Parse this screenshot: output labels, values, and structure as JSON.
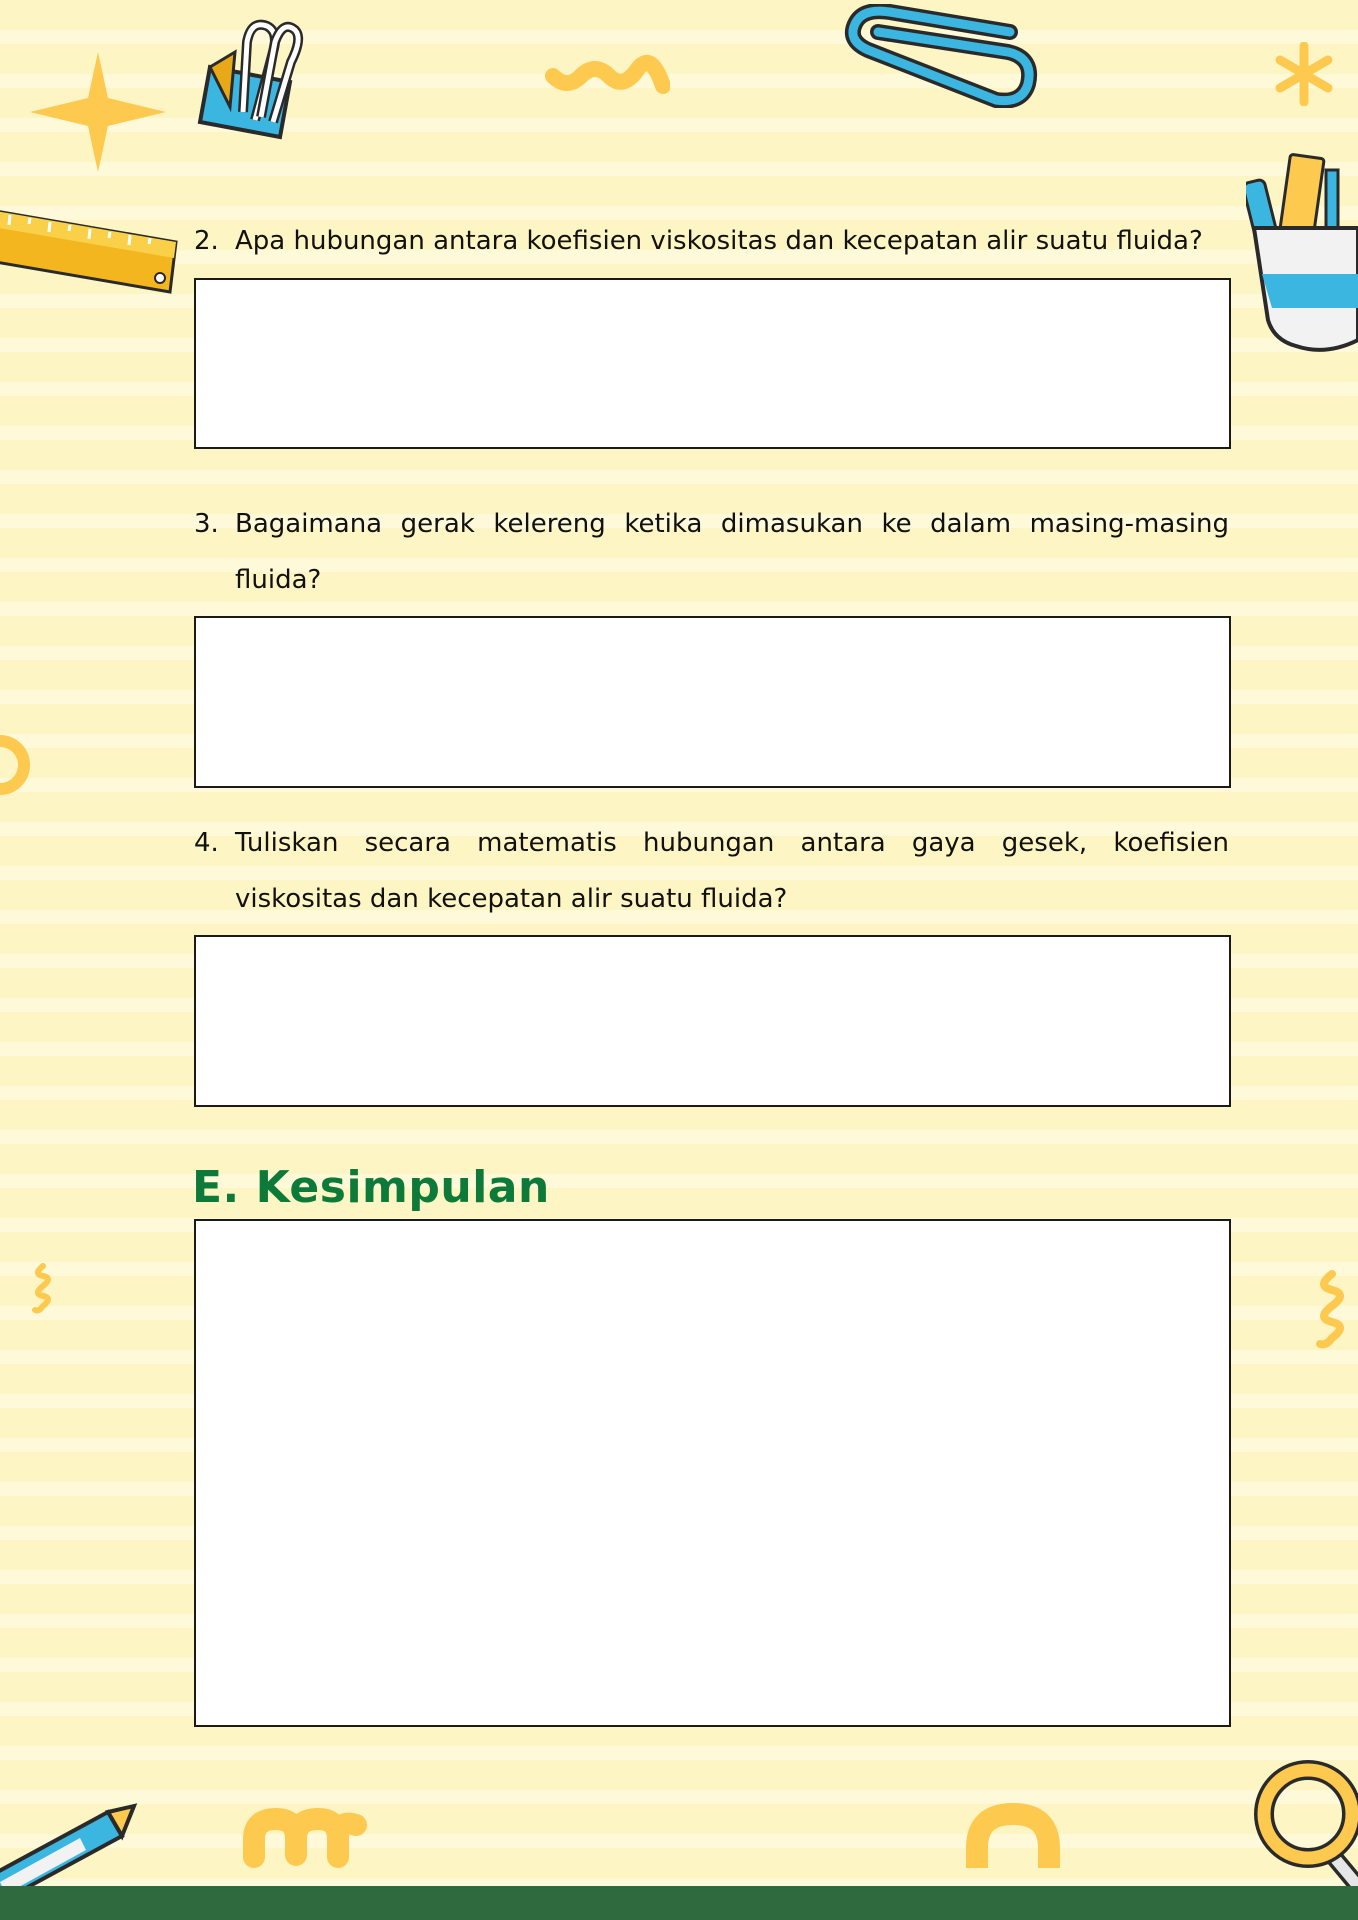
{
  "questions": [
    {
      "number": "2.",
      "text": "Apa hubungan antara koefisien viskositas dan kecepatan alir suatu fluida?"
    },
    {
      "number": "3.",
      "text": "Bagaimana gerak kelereng ketika dimasukan ke dalam masing-masing fluida?"
    },
    {
      "number": "4.",
      "text": "Tuliskan secara matematis hubungan antara gaya gesek, koefisien viskositas dan kecepatan alir suatu fluida?"
    }
  ],
  "conclusion": {
    "title": "E. Kesimpulan"
  },
  "colors": {
    "background": "#fdf6c4",
    "accent_yellow": "#fdc94f",
    "accent_blue": "#3bb6e0",
    "title_green": "#0e7a3a",
    "footer_green": "#2f6a3e"
  },
  "decorations": [
    "star-icon",
    "binder-clip-icon",
    "squiggle-icon",
    "paperclip-icon",
    "asterisk-icon",
    "ruler-icon",
    "pencil-cup-icon",
    "ring-icon",
    "spring-icon",
    "pen-icon",
    "arch-icon",
    "magnifier-icon"
  ]
}
